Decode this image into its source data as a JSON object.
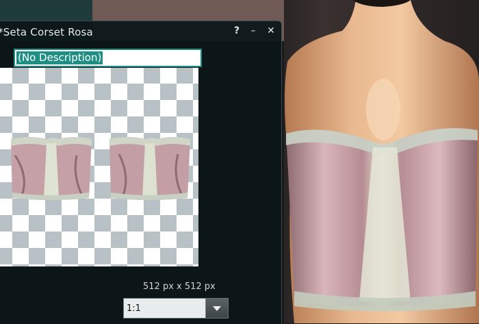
{
  "window": {
    "title": "*Seta Corset Rosa",
    "help_icon": "?",
    "minimize_icon": "–",
    "close_icon": "✕"
  },
  "description": {
    "value": "(No Description)"
  },
  "texture": {
    "dimensions": "512 px x 512 px",
    "aspect_ratio": "1:1",
    "checker_color": "#b8c1c6",
    "garment_color": "#c9a3a8"
  },
  "icons": {
    "help": "help-icon",
    "minimize": "minimize-icon",
    "close": "close-icon",
    "dropdown": "chevron-down-icon"
  }
}
